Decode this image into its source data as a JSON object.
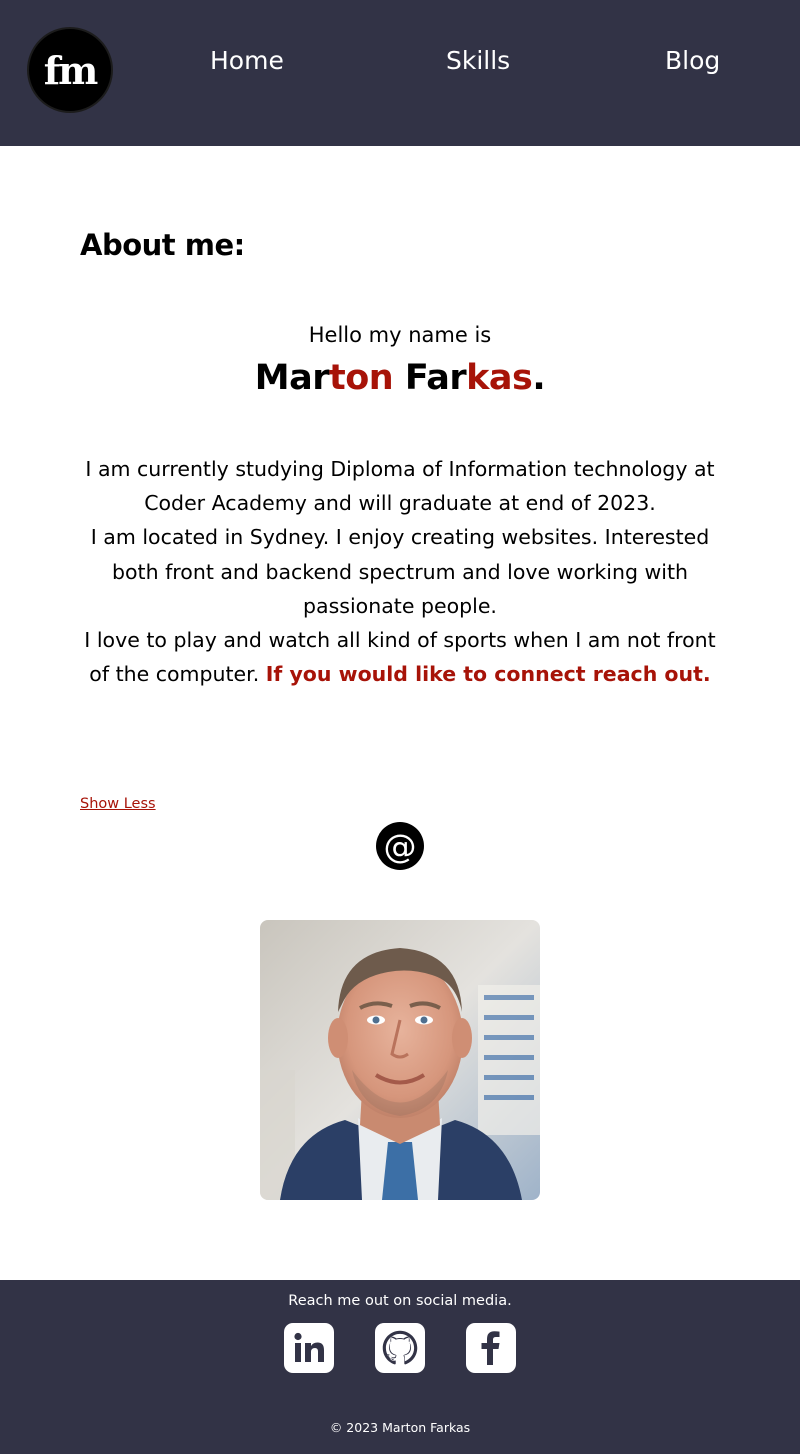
{
  "header": {
    "logo_text": "fm",
    "nav": [
      {
        "label": "Home"
      },
      {
        "label": "Skills"
      },
      {
        "label": "Blog"
      }
    ]
  },
  "about": {
    "title": "About me:",
    "greeting": "Hello my name is",
    "name_parts": {
      "first_a": "Mar",
      "first_b": "ton",
      "last_a": "Far",
      "last_b": "kas",
      "period": "."
    },
    "bio_lines": [
      "I am currently studying Diploma of Information technology at Coder Academy and will graduate at end of 2023.",
      "I am located in Sydney. I enjoy creating websites. Interested both front and backend spectrum and love working with passionate people.",
      "I love to play and watch all kind of sports when I am not front of the computer."
    ],
    "cta": "If you would like to connect reach out.",
    "show_less": "Show Less",
    "email_icon": "@"
  },
  "footer": {
    "heading": "Reach me out on social media.",
    "social": [
      "linkedin-icon",
      "github-icon",
      "facebook-icon"
    ],
    "copyright": "© 2023 Marton Farkas"
  },
  "colors": {
    "header_bg": "#323346",
    "accent_red": "#a71308"
  }
}
